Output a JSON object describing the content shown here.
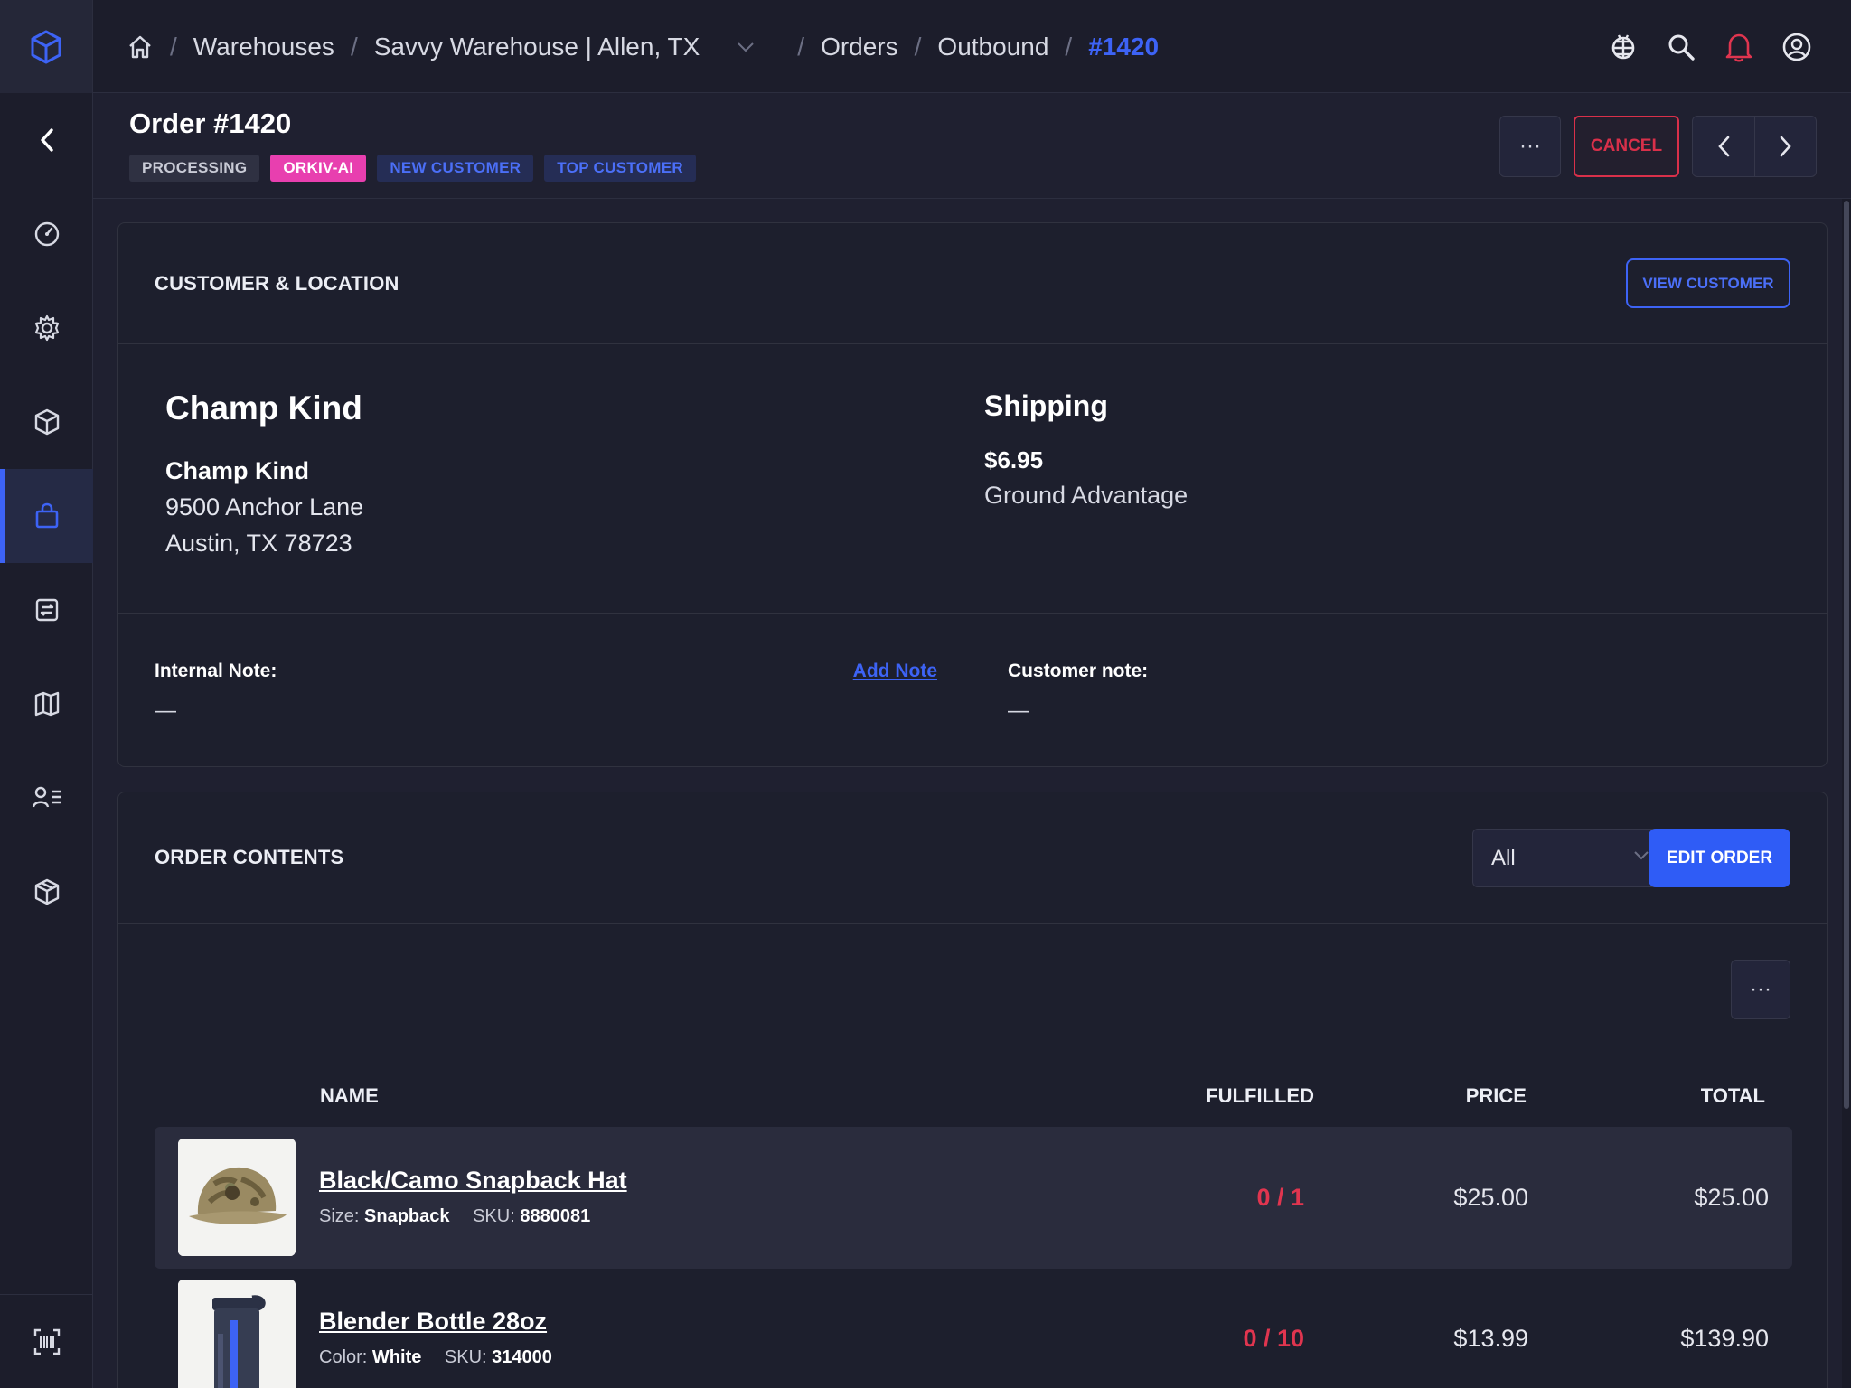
{
  "breadcrumb": {
    "warehouses": "Warehouses",
    "warehouse": "Savvy Warehouse | Allen, TX",
    "orders": "Orders",
    "outbound": "Outbound",
    "current": "#1420",
    "separator": "/"
  },
  "header": {
    "title": "Order #1420",
    "tags": [
      "PROCESSING",
      "ORKIV-AI",
      "NEW CUSTOMER",
      "TOP CUSTOMER"
    ],
    "more_label": "···",
    "cancel_label": "CANCEL"
  },
  "customer_card": {
    "title": "CUSTOMER & LOCATION",
    "view_customer_label": "VIEW CUSTOMER",
    "customer_name": "Champ Kind",
    "address": {
      "name": "Champ Kind",
      "line1": "9500 Anchor Lane",
      "line2": "Austin, TX 78723"
    },
    "shipping": {
      "heading": "Shipping",
      "price": "$6.95",
      "method": "Ground Advantage"
    },
    "internal_note": {
      "label": "Internal Note:",
      "value": "—",
      "add_label": "Add Note"
    },
    "customer_note": {
      "label": "Customer note:",
      "value": "—"
    }
  },
  "order_contents": {
    "title": "ORDER CONTENTS",
    "filter_value": "All",
    "edit_label": "EDIT ORDER",
    "more_label": "···",
    "columns": {
      "name": "NAME",
      "fulfilled": "FULFILLED",
      "price": "PRICE",
      "total": "TOTAL"
    },
    "items": [
      {
        "name": "Black/Camo Snapback Hat",
        "attr_label": "Size:",
        "attr_value": "Snapback",
        "sku_label": "SKU:",
        "sku": "8880081",
        "fulfilled": "0 / 1",
        "price": "$25.00",
        "total": "$25.00"
      },
      {
        "name": "Blender Bottle 28oz",
        "attr_label": "Color:",
        "attr_value": "White",
        "sku_label": "SKU:",
        "sku": "314000",
        "fulfilled": "0 / 10",
        "price": "$13.99",
        "total": "$139.90"
      }
    ]
  },
  "colors": {
    "accent": "#3d63f5",
    "danger": "#d9304a",
    "tag_pink": "#e83faf",
    "background": "#1f2030"
  }
}
